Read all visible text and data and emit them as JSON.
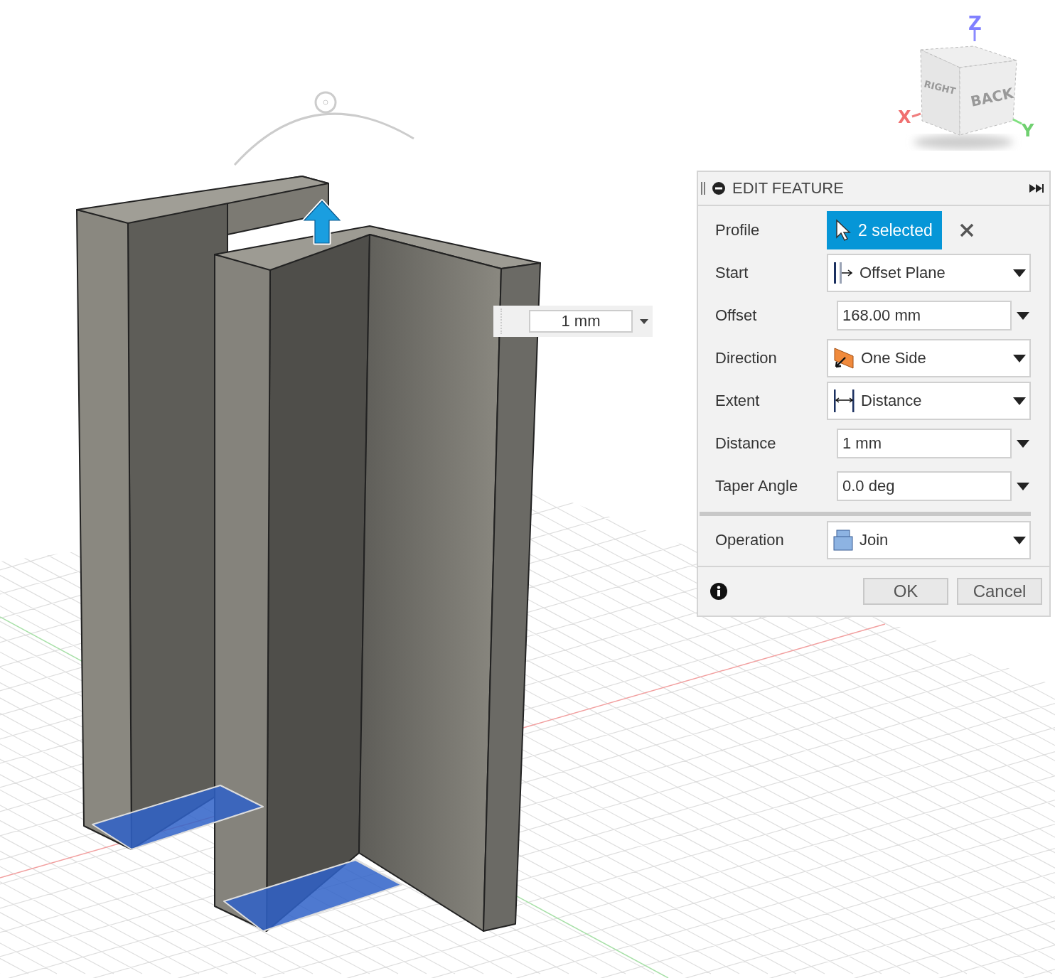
{
  "viewport": {
    "view_cube": {
      "faces": [
        "RIGHT",
        "BACK"
      ],
      "axes": [
        "X",
        "Y",
        "Z"
      ]
    },
    "distance_input": {
      "value": "1 mm"
    }
  },
  "panel": {
    "title": "EDIT FEATURE",
    "rows": [
      {
        "label": "Profile",
        "kind": "selection",
        "value": "2 selected"
      },
      {
        "label": "Start",
        "kind": "dropdown",
        "value": "Offset Plane"
      },
      {
        "label": "Offset",
        "kind": "input",
        "value": "168.00 mm"
      },
      {
        "label": "Direction",
        "kind": "dropdown",
        "value": "One Side"
      },
      {
        "label": "Extent",
        "kind": "dropdown",
        "value": "Distance"
      },
      {
        "label": "Distance",
        "kind": "input",
        "value": "1 mm"
      },
      {
        "label": "Taper Angle",
        "kind": "input",
        "value": "0.0 deg"
      }
    ],
    "operation": {
      "label": "Operation",
      "kind": "dropdown",
      "value": "Join"
    },
    "buttons": [
      {
        "label": "OK"
      },
      {
        "label": "Cancel"
      }
    ]
  }
}
